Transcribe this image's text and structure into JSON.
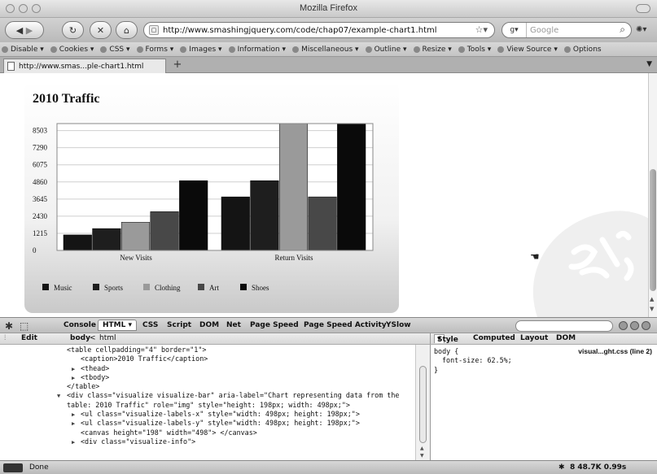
{
  "window": {
    "title": "Mozilla Firefox"
  },
  "navbar": {
    "url": "http://www.smashingjquery.com/code/chap07/example-chart1.html",
    "search_placeholder": "Google"
  },
  "devtoolbar": {
    "items": [
      "Disable",
      "Cookies",
      "CSS",
      "Forms",
      "Images",
      "Information",
      "Miscellaneous",
      "Outline",
      "Resize",
      "Tools",
      "View Source",
      "Options"
    ]
  },
  "tabs": [
    {
      "label": "http://www.smas...ple-chart1.html"
    }
  ],
  "chart_data": {
    "type": "bar",
    "title": "2010 Traffic",
    "categories": [
      "New Visits",
      "Return Visits"
    ],
    "series": [
      {
        "name": "Music",
        "values": [
          1100,
          3800
        ],
        "color": "#141414"
      },
      {
        "name": "Sports",
        "values": [
          1550,
          4950
        ],
        "color": "#1e1e1e"
      },
      {
        "name": "Clothing",
        "values": [
          2000,
          9000
        ],
        "color": "#9a9a9a"
      },
      {
        "name": "Art",
        "values": [
          2750,
          3800
        ],
        "color": "#484848"
      },
      {
        "name": "Shoes",
        "values": [
          4950,
          9000
        ],
        "color": "#0a0a0a"
      }
    ],
    "y_ticks": [
      "8503",
      "7290",
      "6075",
      "4860",
      "3645",
      "2430",
      "1215",
      "0"
    ],
    "ylim": [
      0,
      9000
    ],
    "grid": true,
    "legend_position": "bottom-left"
  },
  "firebug": {
    "tabs": [
      "Console",
      "HTML",
      "CSS",
      "Script",
      "DOM",
      "Net",
      "Page Speed",
      "Page Speed Activity",
      "YSlow"
    ],
    "active_tab": "HTML",
    "edit_label": "Edit",
    "breadcrumb": [
      "body",
      "html"
    ],
    "side_tabs": [
      "Style",
      "Computed",
      "Layout",
      "DOM"
    ],
    "html_lines": [
      "<table cellpadding=\"4\" border=\"1\">",
      "<caption>2010 Traffic</caption>",
      "<thead>",
      "<tbody>",
      "</table>",
      "<div class=\"visualize visualize-bar\" aria-label=\"Chart representing data from the",
      "table: 2010 Traffic\" role=\"img\" style=\"height: 198px; width: 498px;\">",
      "<ul class=\"visualize-labels-x\" style=\"width: 498px; height: 198px;\">",
      "<ul class=\"visualize-labels-y\" style=\"width: 498px; height: 198px;\">",
      "<canvas height=\"198\" width=\"498\"> </canvas>",
      "<div class=\"visualize-info\">"
    ],
    "style_rule": {
      "selector": "body {",
      "property": "font-size: 62.5%;",
      "close": "}",
      "source": "visual...ght.css (line 2)"
    }
  },
  "statusbar": {
    "text": "Done",
    "size": "8  48.7K  0.99s"
  }
}
